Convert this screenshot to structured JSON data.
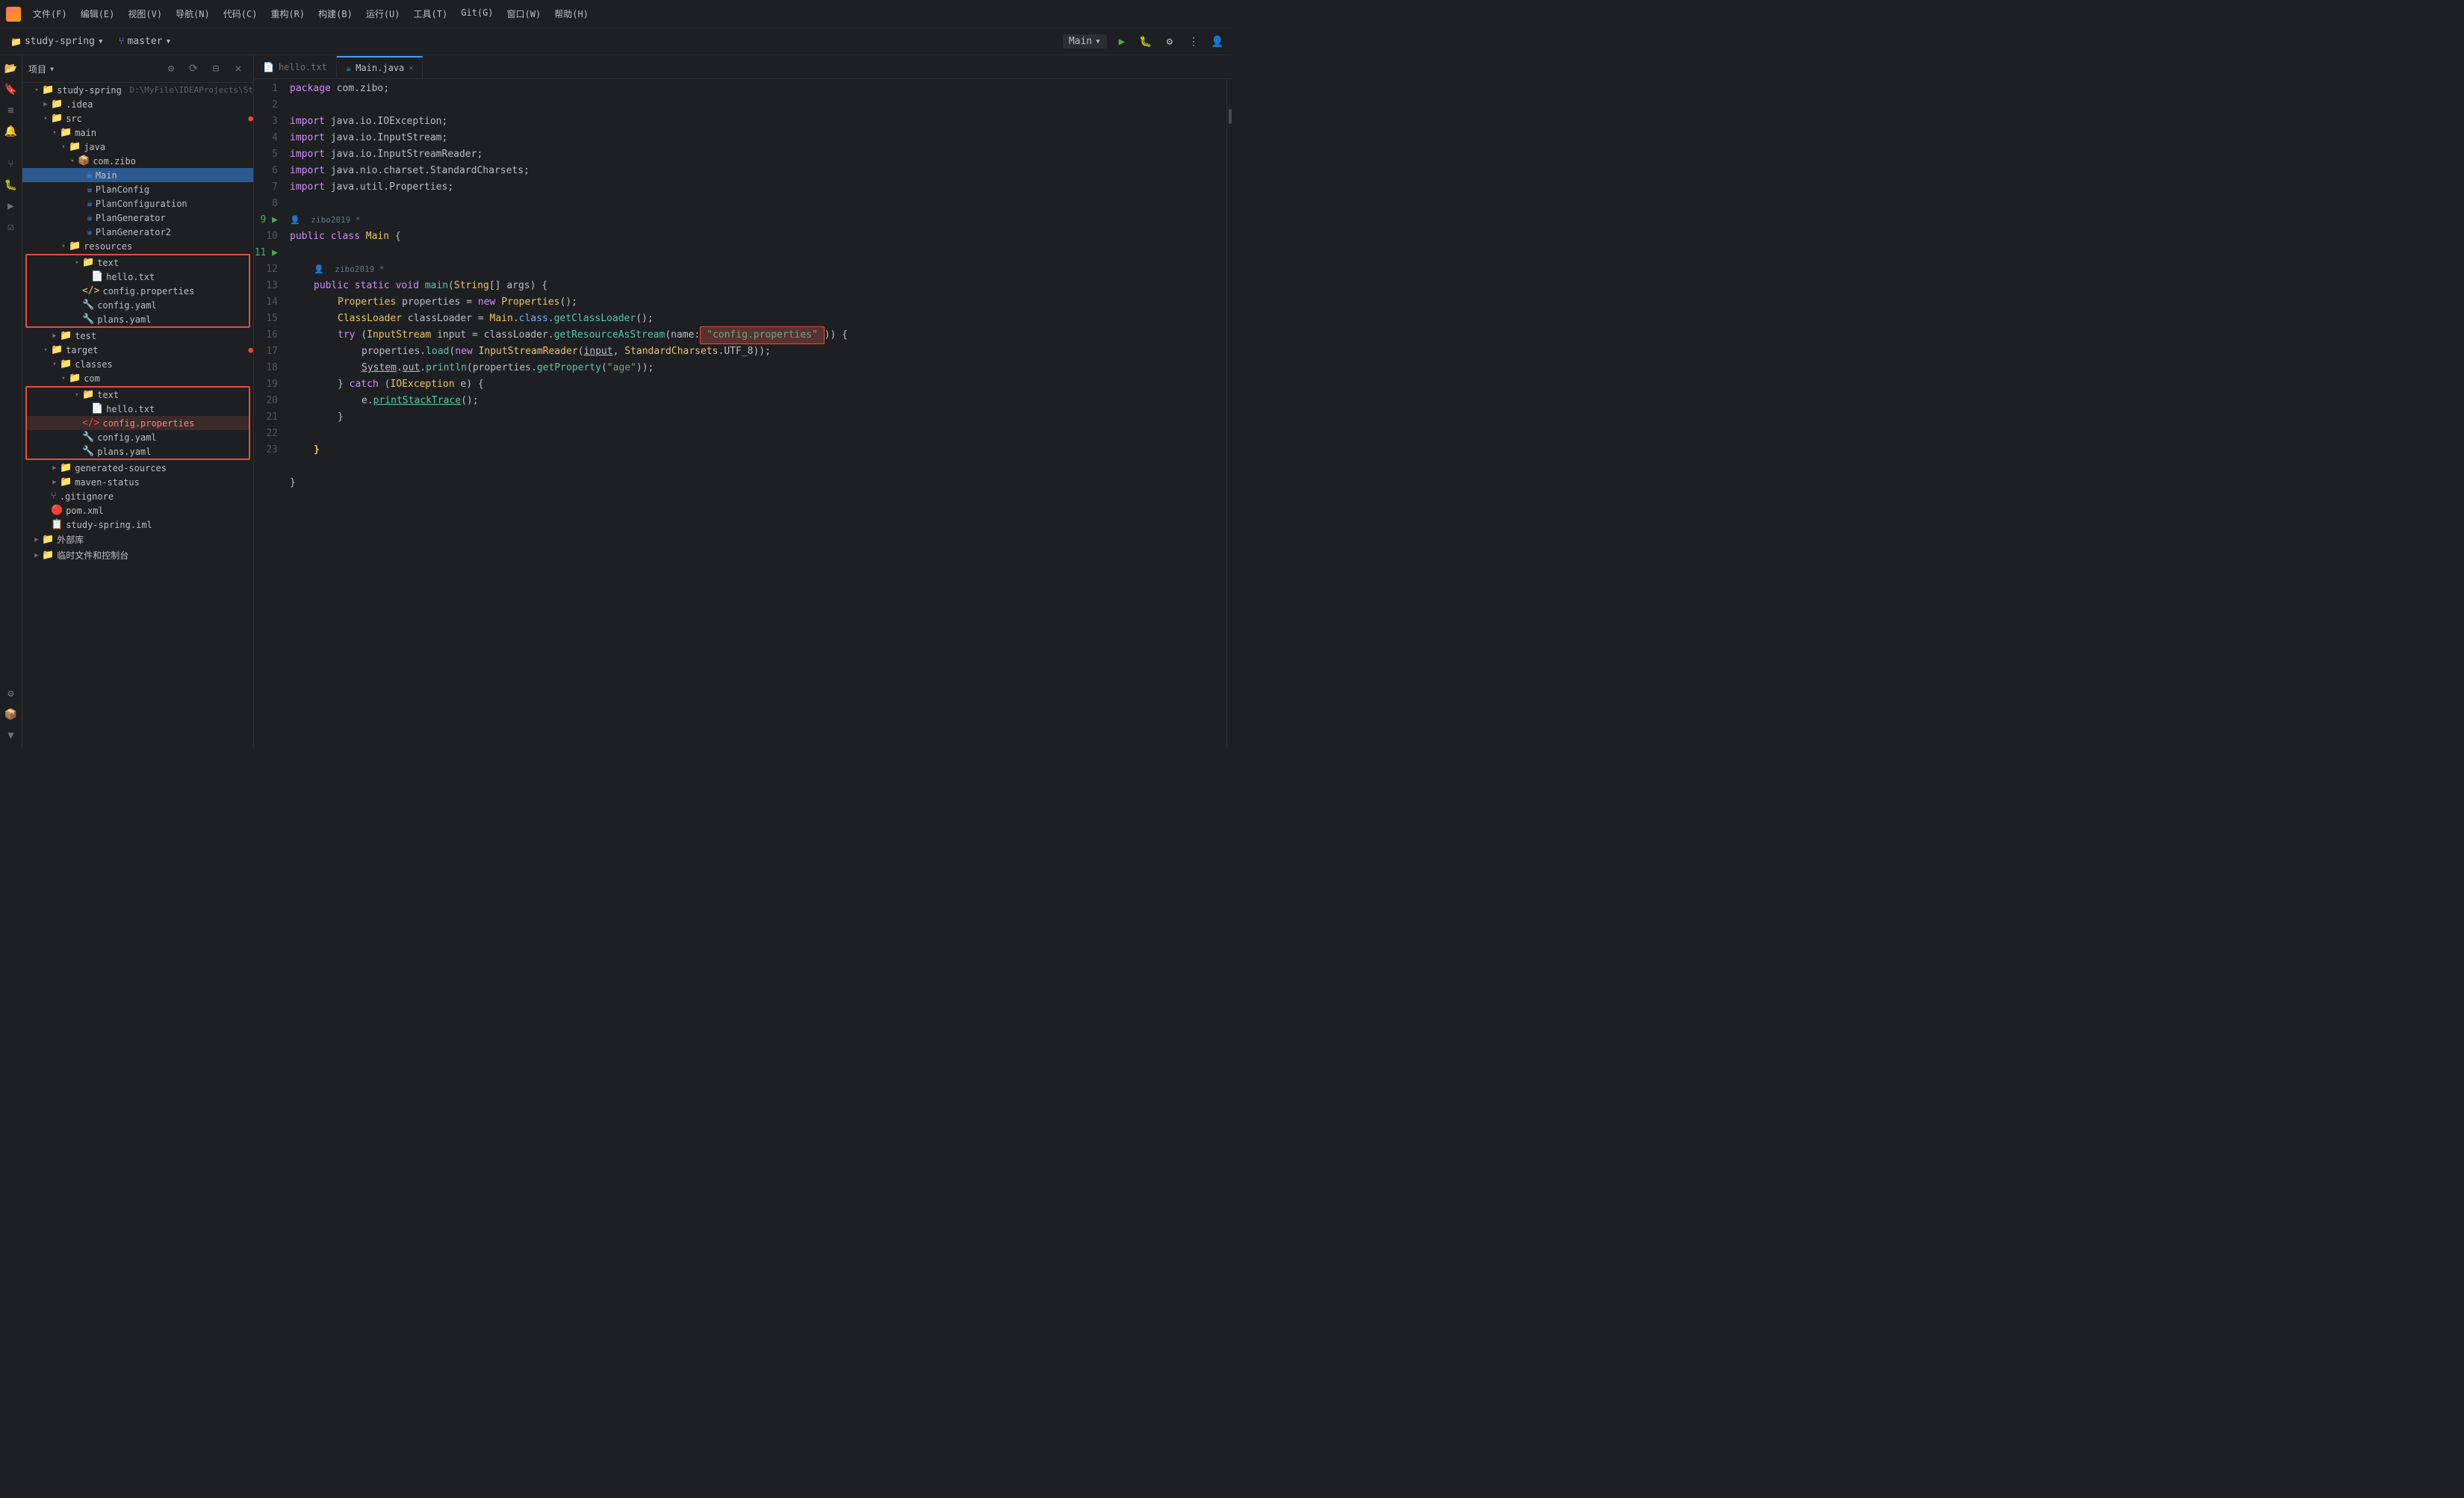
{
  "titlebar": {
    "menus": [
      "文件(F)",
      "编辑(E)",
      "视图(V)",
      "导航(N)",
      "代码(C)",
      "重构(R)",
      "构建(B)",
      "运行(U)",
      "工具(T)",
      "Git(G)",
      "窗口(W)",
      "帮助(H)"
    ]
  },
  "toolbar": {
    "project": "study-spring",
    "branch": "master",
    "run_config": "Main",
    "chevron": "▾"
  },
  "file_tree": {
    "header": "项目",
    "root": "study-spring D:\\MyFile\\IDEAProjects\\St",
    "items": [
      {
        "label": ".idea",
        "type": "folder",
        "indent": 1
      },
      {
        "label": "src",
        "type": "folder",
        "indent": 1
      },
      {
        "label": "main",
        "type": "folder",
        "indent": 2
      },
      {
        "label": "java",
        "type": "folder",
        "indent": 3
      },
      {
        "label": "com.zibo",
        "type": "package",
        "indent": 4
      },
      {
        "label": "Main",
        "type": "java",
        "indent": 5,
        "selected": true
      },
      {
        "label": "PlanConfig",
        "type": "java",
        "indent": 5
      },
      {
        "label": "PlanConfiguration",
        "type": "java",
        "indent": 5
      },
      {
        "label": "PlanGenerator",
        "type": "java",
        "indent": 5
      },
      {
        "label": "PlanGenerator2",
        "type": "java",
        "indent": 5
      },
      {
        "label": "resources",
        "type": "folder",
        "indent": 3
      },
      {
        "label": "text",
        "type": "folder",
        "indent": 4
      },
      {
        "label": "hello.txt",
        "type": "txt",
        "indent": 5
      },
      {
        "label": "config.properties",
        "type": "props",
        "indent": 4
      },
      {
        "label": "config.yaml",
        "type": "yaml",
        "indent": 4
      },
      {
        "label": "plans.yaml",
        "type": "yaml",
        "indent": 4
      },
      {
        "label": "test",
        "type": "folder",
        "indent": 2
      },
      {
        "label": "target",
        "type": "folder",
        "indent": 1
      },
      {
        "label": "classes",
        "type": "folder",
        "indent": 2
      },
      {
        "label": "com",
        "type": "folder",
        "indent": 3
      },
      {
        "label": "text",
        "type": "folder",
        "indent": 4
      },
      {
        "label": "hello.txt",
        "type": "txt",
        "indent": 5
      },
      {
        "label": "config.properties",
        "type": "props",
        "indent": 5
      },
      {
        "label": "config.yaml",
        "type": "yaml",
        "indent": 5
      },
      {
        "label": "plans.yaml",
        "type": "yaml",
        "indent": 5
      },
      {
        "label": "generated-sources",
        "type": "folder",
        "indent": 2
      },
      {
        "label": "maven-status",
        "type": "folder",
        "indent": 2
      },
      {
        "label": ".gitignore",
        "type": "git",
        "indent": 1
      },
      {
        "label": "pom.xml",
        "type": "xml",
        "indent": 1
      },
      {
        "label": "study-spring.iml",
        "type": "iml",
        "indent": 1
      },
      {
        "label": "外部库",
        "type": "folder",
        "indent": 0
      },
      {
        "label": "临时文件和控制台",
        "type": "folder",
        "indent": 0
      }
    ]
  },
  "tabs": [
    {
      "label": "hello.txt",
      "type": "txt",
      "active": false
    },
    {
      "label": "Main.java",
      "type": "java",
      "active": true
    }
  ],
  "editor": {
    "lines": [
      {
        "num": 1,
        "code": "package_com_zibo"
      },
      {
        "num": 2,
        "code": "empty"
      },
      {
        "num": 3,
        "code": "import_ioexception"
      },
      {
        "num": 4,
        "code": "import_inputstream"
      },
      {
        "num": 5,
        "code": "import_inputstreamreader"
      },
      {
        "num": 6,
        "code": "import_standardcharsets"
      },
      {
        "num": 7,
        "code": "import_properties"
      },
      {
        "num": 8,
        "code": "empty"
      },
      {
        "num": 9,
        "code": "public_class_main"
      },
      {
        "num": 10,
        "code": "empty"
      },
      {
        "num": 11,
        "code": "public_static_void_main"
      },
      {
        "num": 12,
        "code": "properties_new"
      },
      {
        "num": 13,
        "code": "classloader"
      },
      {
        "num": 14,
        "code": "try_inputstream"
      },
      {
        "num": 15,
        "code": "properties_load"
      },
      {
        "num": 16,
        "code": "system_out"
      },
      {
        "num": 17,
        "code": "catch"
      },
      {
        "num": 18,
        "code": "print_stack"
      },
      {
        "num": 19,
        "code": "close_catch"
      },
      {
        "num": 20,
        "code": "empty"
      },
      {
        "num": 21,
        "code": "close_main"
      },
      {
        "num": 22,
        "code": "empty"
      },
      {
        "num": 23,
        "code": "close_class"
      }
    ]
  },
  "annotations": {
    "zibo2019_1": "zibo2019 *",
    "zibo2019_2": "zibo2019 *"
  }
}
